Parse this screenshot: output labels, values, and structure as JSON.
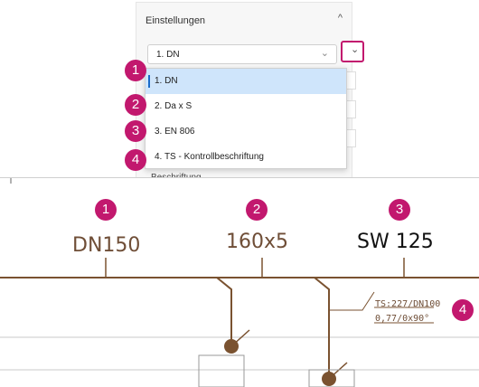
{
  "settings": {
    "title": "Einstellungen",
    "collapse_glyph": "^",
    "select_value": "1. DN",
    "select_glyph": "⌄",
    "button_glyph": "⌄",
    "next_section_partial": "Beschriftung",
    "next_section_glyph": "⌄"
  },
  "dropdown": {
    "options": [
      {
        "label": "1. DN",
        "selected": true
      },
      {
        "label": "2. Da x S",
        "selected": false
      },
      {
        "label": "3. EN 806",
        "selected": false
      },
      {
        "label": "4. TS - Kontrollbeschriftung",
        "selected": false
      }
    ]
  },
  "markers": [
    "1",
    "2",
    "3",
    "4"
  ],
  "drawing": {
    "labels": [
      "DN150",
      "160x5",
      "SW 125"
    ],
    "control_label_line1": "TS:227/DN100",
    "control_label_line2": "0,77/0x90°",
    "pipe_color": "#7a5230",
    "node_color": "#7a5230"
  },
  "colors": {
    "accent": "#c2186e",
    "selection": "#cfe5fb"
  }
}
